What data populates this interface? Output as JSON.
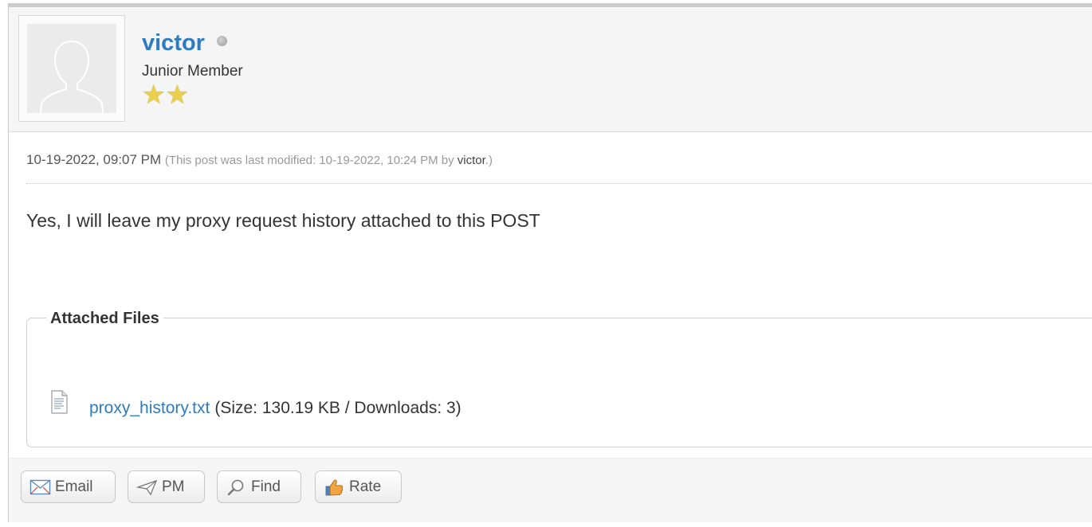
{
  "author": {
    "username": "victor",
    "title": "Junior Member",
    "star_count": 2,
    "online_status": "offline",
    "avatar_icon": "default-avatar-icon"
  },
  "meta": {
    "date": "10-19-2022, 09:07 PM",
    "edited_prefix": "(This post was last modified: 10-19-2022, 10:24 PM by ",
    "edited_by": "victor",
    "edited_suffix": ".)"
  },
  "post": {
    "text": "Yes, I will leave my proxy request history attached to this POST"
  },
  "attachments": {
    "legend": "Attached Files",
    "files": [
      {
        "icon": "text-file-icon",
        "name": "proxy_history.txt",
        "info": "(Size: 130.19 KB / Downloads: 3)"
      }
    ]
  },
  "buttons": {
    "email": "Email",
    "pm": "PM",
    "find": "Find",
    "rate": "Rate"
  },
  "colors": {
    "link": "#2e7bbf",
    "star": "#e9cf4c",
    "border": "#cccccc",
    "panel": "#f5f5f5"
  }
}
